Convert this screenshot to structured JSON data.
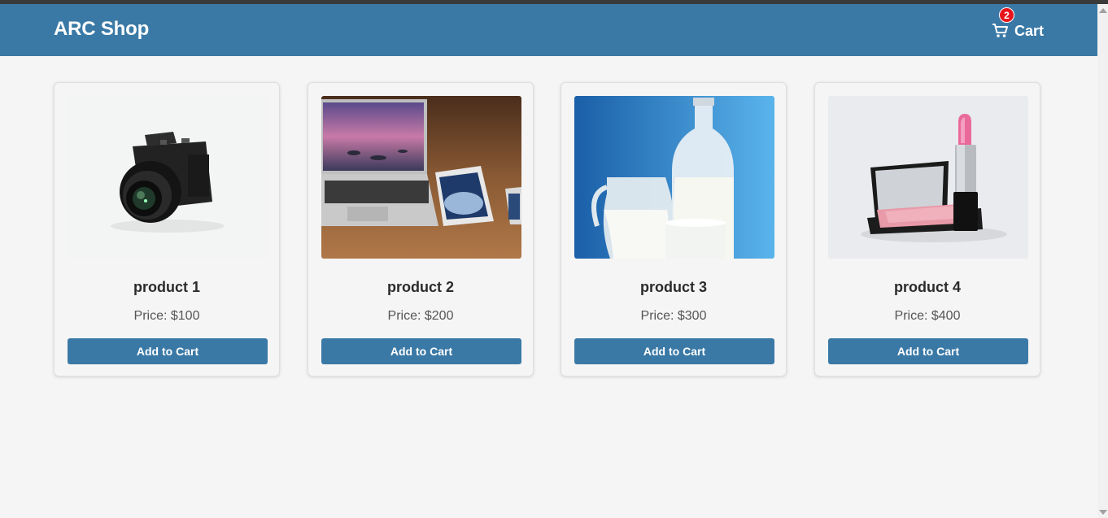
{
  "header": {
    "brand": "ARC Shop",
    "cart_label": "Cart",
    "cart_count": "2",
    "cart_icon": "cart-icon"
  },
  "colors": {
    "header": "#3a79a6",
    "badge": "#e8141c",
    "background": "#f5f5f5"
  },
  "products": [
    {
      "name": "product 1",
      "price": "Price: $100",
      "button": "Add to Cart",
      "image": "camera"
    },
    {
      "name": "product 2",
      "price": "Price: $200",
      "button": "Add to Cart",
      "image": "laptop-and-tablets"
    },
    {
      "name": "product 3",
      "price": "Price: $300",
      "button": "Add to Cart",
      "image": "milk-bottles"
    },
    {
      "name": "product 4",
      "price": "Price: $400",
      "button": "Add to Cart",
      "image": "lipstick-and-blush"
    }
  ]
}
